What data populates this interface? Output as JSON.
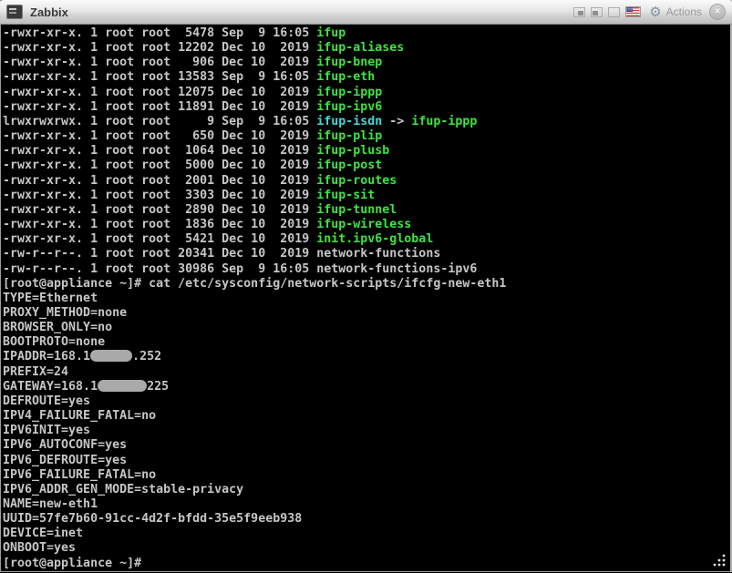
{
  "window": {
    "title": "Zabbix",
    "titlebar": {
      "actions_label": "Actions",
      "icons": {
        "app": "terminal-icon",
        "pane_buttons": [
          "window-pane-fill-right-icon",
          "window-pane-fill-left-icon",
          "window-pane-empty-icon"
        ],
        "keyboard_layout": "us-flag-icon",
        "menu": "gear-icon",
        "close": "close-x-icon",
        "resize": "resize-grip-icon"
      }
    }
  },
  "colors": {
    "bg": "#000000",
    "fg": "#c6c6c6",
    "green": "#3fe43f",
    "cyan": "#43d9d9",
    "redact": "#a9a9a9",
    "titlebar_top": "#fbfbfb",
    "titlebar_bottom": "#bdbdbd"
  },
  "terminal": {
    "prompt": "[root@appliance ~]#",
    "lines": [
      [
        {
          "t": "-rwxr-xr-x. 1 root root  5478 Sep  9 16:05 ",
          "c": "fg"
        },
        {
          "t": "ifup",
          "c": "green"
        }
      ],
      [
        {
          "t": "-rwxr-xr-x. 1 root root 12202 Dec 10  2019 ",
          "c": "fg"
        },
        {
          "t": "ifup-aliases",
          "c": "green"
        }
      ],
      [
        {
          "t": "-rwxr-xr-x. 1 root root   906 Dec 10  2019 ",
          "c": "fg"
        },
        {
          "t": "ifup-bnep",
          "c": "green"
        }
      ],
      [
        {
          "t": "-rwxr-xr-x. 1 root root 13583 Sep  9 16:05 ",
          "c": "fg"
        },
        {
          "t": "ifup-eth",
          "c": "green"
        }
      ],
      [
        {
          "t": "-rwxr-xr-x. 1 root root 12075 Dec 10  2019 ",
          "c": "fg"
        },
        {
          "t": "ifup-ippp",
          "c": "green"
        }
      ],
      [
        {
          "t": "-rwxr-xr-x. 1 root root 11891 Dec 10  2019 ",
          "c": "fg"
        },
        {
          "t": "ifup-ipv6",
          "c": "green"
        }
      ],
      [
        {
          "t": "lrwxrwxrwx. 1 root root     9 Sep  9 16:05 ",
          "c": "fg"
        },
        {
          "t": "ifup-isdn",
          "c": "cyan"
        },
        {
          "t": " -> ",
          "c": "fg"
        },
        {
          "t": "ifup-ippp",
          "c": "green"
        }
      ],
      [
        {
          "t": "-rwxr-xr-x. 1 root root   650 Dec 10  2019 ",
          "c": "fg"
        },
        {
          "t": "ifup-plip",
          "c": "green"
        }
      ],
      [
        {
          "t": "-rwxr-xr-x. 1 root root  1064 Dec 10  2019 ",
          "c": "fg"
        },
        {
          "t": "ifup-plusb",
          "c": "green"
        }
      ],
      [
        {
          "t": "-rwxr-xr-x. 1 root root  5000 Dec 10  2019 ",
          "c": "fg"
        },
        {
          "t": "ifup-post",
          "c": "green"
        }
      ],
      [
        {
          "t": "-rwxr-xr-x. 1 root root  2001 Dec 10  2019 ",
          "c": "fg"
        },
        {
          "t": "ifup-routes",
          "c": "green"
        }
      ],
      [
        {
          "t": "-rwxr-xr-x. 1 root root  3303 Dec 10  2019 ",
          "c": "fg"
        },
        {
          "t": "ifup-sit",
          "c": "green"
        }
      ],
      [
        {
          "t": "-rwxr-xr-x. 1 root root  2890 Dec 10  2019 ",
          "c": "fg"
        },
        {
          "t": "ifup-tunnel",
          "c": "green"
        }
      ],
      [
        {
          "t": "-rwxr-xr-x. 1 root root  1836 Dec 10  2019 ",
          "c": "fg"
        },
        {
          "t": "ifup-wireless",
          "c": "green"
        }
      ],
      [
        {
          "t": "-rwxr-xr-x. 1 root root  5421 Dec 10  2019 ",
          "c": "fg"
        },
        {
          "t": "init.ipv6-global",
          "c": "green"
        }
      ],
      [
        {
          "t": "-rw-r--r--. 1 root root 20341 Dec 10  2019 network-functions",
          "c": "fg"
        }
      ],
      [
        {
          "t": "-rw-r--r--. 1 root root 30986 Sep  9 16:05 network-functions-ipv6",
          "c": "fg"
        }
      ],
      [
        {
          "t": "[root@appliance ~]# cat /etc/sysconfig/network-scripts/ifcfg-new-eth1",
          "c": "fg"
        }
      ],
      [
        {
          "t": "TYPE=Ethernet",
          "c": "fg"
        }
      ],
      [
        {
          "t": "PROXY_METHOD=none",
          "c": "fg"
        }
      ],
      [
        {
          "t": "BROWSER_ONLY=no",
          "c": "fg"
        }
      ],
      [
        {
          "t": "BOOTPROTO=none",
          "c": "fg"
        }
      ],
      [
        {
          "t": "IPADDR=168.1",
          "c": "fg"
        },
        {
          "redact": true,
          "w": 46
        },
        {
          "t": ".252",
          "c": "fg"
        }
      ],
      [
        {
          "t": "PREFIX=24",
          "c": "fg"
        }
      ],
      [
        {
          "t": "GATEWAY=168.1",
          "c": "fg"
        },
        {
          "redact": true,
          "w": 54
        },
        {
          "t": "225",
          "c": "fg"
        }
      ],
      [
        {
          "t": "DEFROUTE=yes",
          "c": "fg"
        }
      ],
      [
        {
          "t": "IPV4_FAILURE_FATAL=no",
          "c": "fg"
        }
      ],
      [
        {
          "t": "IPV6INIT=yes",
          "c": "fg"
        }
      ],
      [
        {
          "t": "IPV6_AUTOCONF=yes",
          "c": "fg"
        }
      ],
      [
        {
          "t": "IPV6_DEFROUTE=yes",
          "c": "fg"
        }
      ],
      [
        {
          "t": "IPV6_FAILURE_FATAL=no",
          "c": "fg"
        }
      ],
      [
        {
          "t": "IPV6_ADDR_GEN_MODE=stable-privacy",
          "c": "fg"
        }
      ],
      [
        {
          "t": "NAME=new-eth1",
          "c": "fg"
        }
      ],
      [
        {
          "t": "UUID=57fe7b60-91cc-4d2f-bfdd-35e5f9eeb938",
          "c": "fg"
        }
      ],
      [
        {
          "t": "DEVICE=inet",
          "c": "fg"
        }
      ],
      [
        {
          "t": "ONBOOT=yes",
          "c": "fg"
        }
      ],
      [
        {
          "t": "[root@appliance ~]#",
          "c": "fg"
        }
      ]
    ]
  }
}
